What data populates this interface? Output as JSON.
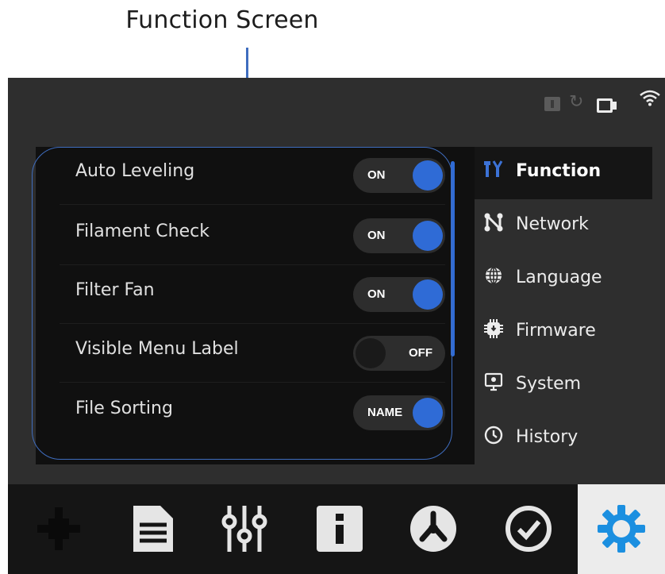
{
  "annotation": {
    "caption": "Function Screen",
    "highlight_color": "#3f6dbf"
  },
  "status_bar": {
    "icons": [
      "sd-card-icon",
      "refresh-icon",
      "camera-icon",
      "wifi-icon"
    ]
  },
  "settings": {
    "rows": [
      {
        "label": "Auto Leveling",
        "toggle": "ON",
        "state": "on"
      },
      {
        "label": "Filament Check",
        "toggle": "ON",
        "state": "on"
      },
      {
        "label": "Filter Fan",
        "toggle": "ON",
        "state": "on"
      },
      {
        "label": "Visible Menu Label",
        "toggle": "OFF",
        "state": "off"
      },
      {
        "label": "File Sorting",
        "toggle": "NAME",
        "state": "on"
      }
    ],
    "accent": "#2f6bd6"
  },
  "sidebar": {
    "items": [
      {
        "label": "Function",
        "icon": "tools-icon",
        "active": true
      },
      {
        "label": "Network",
        "icon": "network-icon"
      },
      {
        "label": "Language",
        "icon": "globe-icon"
      },
      {
        "label": "Firmware",
        "icon": "firmware-chip-icon"
      },
      {
        "label": "System",
        "icon": "system-monitor-icon"
      },
      {
        "label": "History",
        "icon": "clock-icon"
      }
    ]
  },
  "bottom_nav": {
    "items": [
      {
        "name": "move-axis-icon"
      },
      {
        "name": "file-icon"
      },
      {
        "name": "adjust-sliders-icon"
      },
      {
        "name": "info-icon"
      },
      {
        "name": "fan-icon"
      },
      {
        "name": "check-icon"
      },
      {
        "name": "settings-gear-icon",
        "active": true
      }
    ],
    "active_color": "#1b8fe0"
  }
}
